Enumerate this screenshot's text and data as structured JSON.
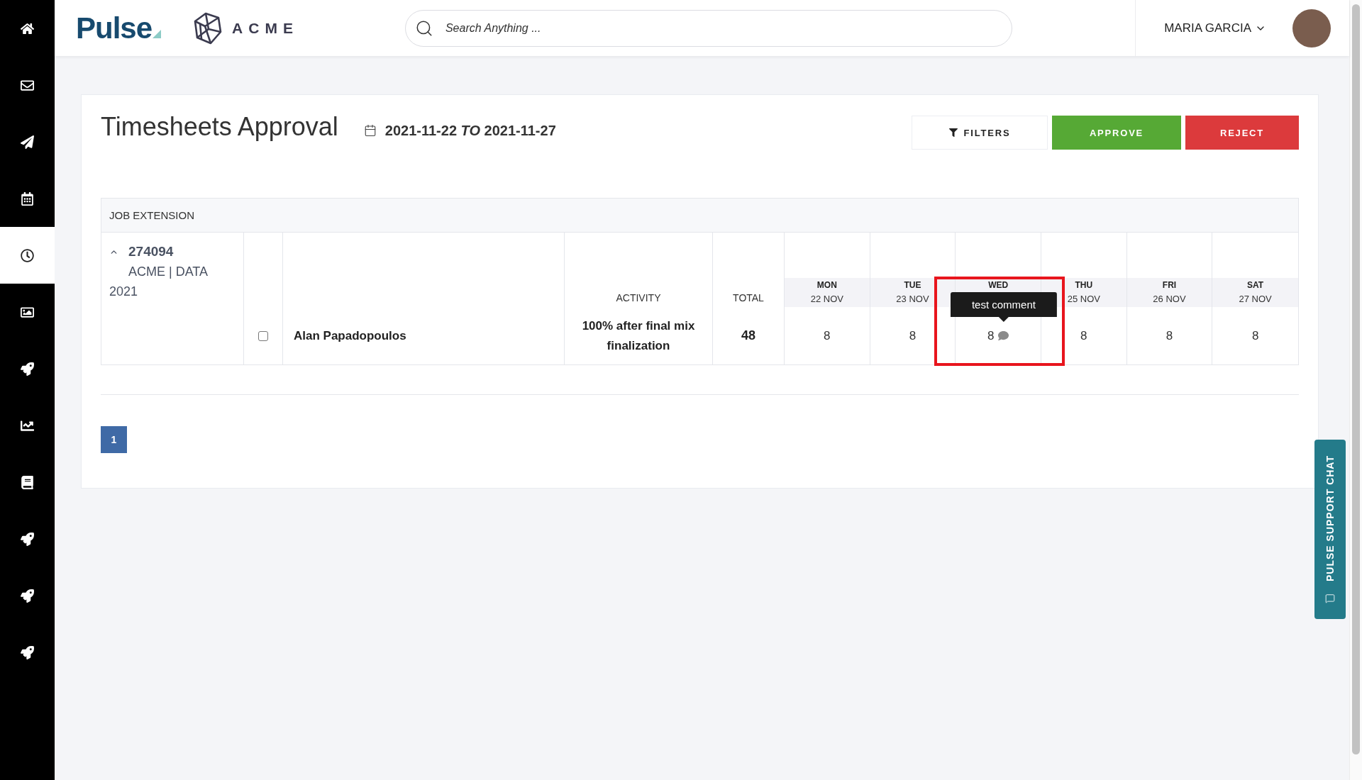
{
  "sidebar": {
    "items": [
      {
        "kind": "home",
        "selected": false
      },
      {
        "kind": "mail",
        "selected": false
      },
      {
        "kind": "send",
        "selected": false
      },
      {
        "kind": "calendar",
        "selected": false
      },
      {
        "kind": "clock",
        "selected": true
      },
      {
        "kind": "image",
        "selected": false
      },
      {
        "kind": "rocket",
        "selected": false
      },
      {
        "kind": "chart",
        "selected": false
      },
      {
        "kind": "book",
        "selected": false
      },
      {
        "kind": "rocket",
        "selected": false
      },
      {
        "kind": "rocket",
        "selected": false
      },
      {
        "kind": "rocket",
        "selected": false
      }
    ]
  },
  "header": {
    "brand": "Pulse",
    "client_logo": "ACME",
    "search": {
      "placeholder": "Search Anything ..."
    },
    "user": {
      "name": "MARIA GARCIA"
    }
  },
  "page": {
    "title": "Timesheets Approval",
    "date_range": "2021-11-22 *TO* 2021-11-27",
    "buttons": [
      {
        "kind": "filter",
        "label": "FILTERS"
      },
      {
        "kind": "approve",
        "label": "APPROVE"
      },
      {
        "kind": "reject",
        "label": "REJECT"
      }
    ]
  },
  "table": {
    "group": "JOB EXTENSION",
    "job": {
      "number": "274094",
      "name": "ACME | DATA 2021",
      "expanded": true
    },
    "columns": {
      "activity": "ACTIVITY",
      "total": "TOTAL",
      "days": [
        {
          "day": "MON",
          "date": "22 NOV",
          "highlighted": false
        },
        {
          "day": "TUE",
          "date": "23 NOV",
          "highlighted": false
        },
        {
          "day": "WED",
          "highlighted": true
        },
        {
          "day": "THU",
          "date": "25 NOV",
          "highlighted": false
        },
        {
          "day": "FRI",
          "date": "26 NOV",
          "highlighted": false
        },
        {
          "day": "SAT",
          "date": "27 NOV",
          "highlighted": false
        }
      ]
    },
    "rows": [
      {
        "checked": false,
        "employee": "Alan Papadopoulos",
        "activity": "100% after final mix finalization",
        "total": "48",
        "hours": [
          {
            "value": "8"
          },
          {
            "value": "8"
          },
          {
            "value": "8",
            "comment": {
              "text": "test comment",
              "open": true
            }
          },
          {
            "value": "8"
          },
          {
            "value": "8"
          },
          {
            "value": "8"
          }
        ]
      }
    ]
  },
  "pagination": [
    {
      "label": "1",
      "selected": true
    }
  ],
  "support_chat": {
    "label": "PULSE SUPPORT CHAT"
  }
}
